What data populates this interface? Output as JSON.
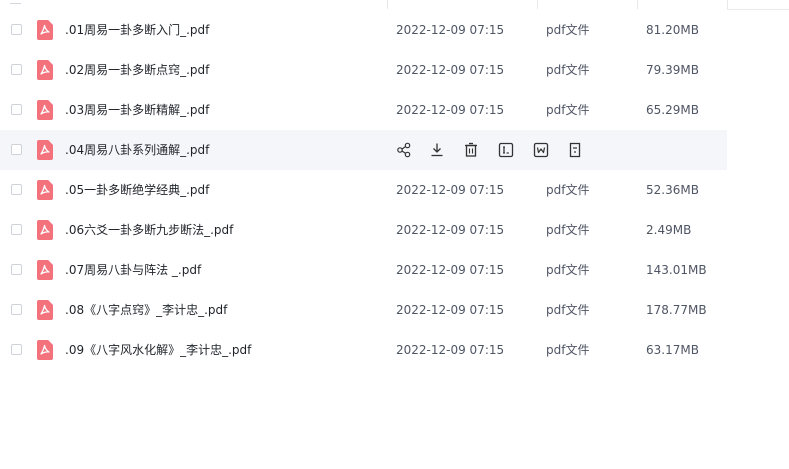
{
  "colors": {
    "pdf_icon": "#f3727c",
    "hover_row": "#f5f6fa",
    "text_primary": "#1f2329",
    "text_secondary": "#4e5563"
  },
  "files": [
    {
      "name": ".01周易一卦多断入门_.pdf",
      "date": "2022-12-09 07:15",
      "type": "pdf文件",
      "size": "81.20MB",
      "icon": "pdf-icon"
    },
    {
      "name": ".02周易一卦多断点窍_.pdf",
      "date": "2022-12-09 07:15",
      "type": "pdf文件",
      "size": "79.39MB",
      "icon": "pdf-icon"
    },
    {
      "name": ".03周易一卦多断精解_.pdf",
      "date": "2022-12-09 07:15",
      "type": "pdf文件",
      "size": "65.29MB",
      "icon": "pdf-icon"
    },
    {
      "name": ".04周易八卦系列通解_.pdf",
      "date": "",
      "type": "",
      "size": "",
      "icon": "pdf-icon",
      "hovered": true
    },
    {
      "name": ".05一卦多断绝学经典_.pdf",
      "date": "2022-12-09 07:15",
      "type": "pdf文件",
      "size": "52.36MB",
      "icon": "pdf-icon"
    },
    {
      "name": ".06六爻一卦多断九步断法_.pdf",
      "date": "2022-12-09 07:15",
      "type": "pdf文件",
      "size": "2.49MB",
      "icon": "pdf-icon"
    },
    {
      "name": ".07周易八卦与阵法 _.pdf",
      "date": "2022-12-09 07:15",
      "type": "pdf文件",
      "size": "143.01MB",
      "icon": "pdf-icon"
    },
    {
      "name": ".08《八字点窍》_李计忠_.pdf",
      "date": "2022-12-09 07:15",
      "type": "pdf文件",
      "size": "178.77MB",
      "icon": "pdf-icon"
    },
    {
      "name": ".09《八字风水化解》_李计忠_.pdf",
      "date": "2022-12-09 07:15",
      "type": "pdf文件",
      "size": "63.17MB",
      "icon": "pdf-icon"
    }
  ],
  "hover_actions": [
    "share-icon",
    "download-icon",
    "delete-icon",
    "rename-icon",
    "copy-icon",
    "more-icon"
  ]
}
